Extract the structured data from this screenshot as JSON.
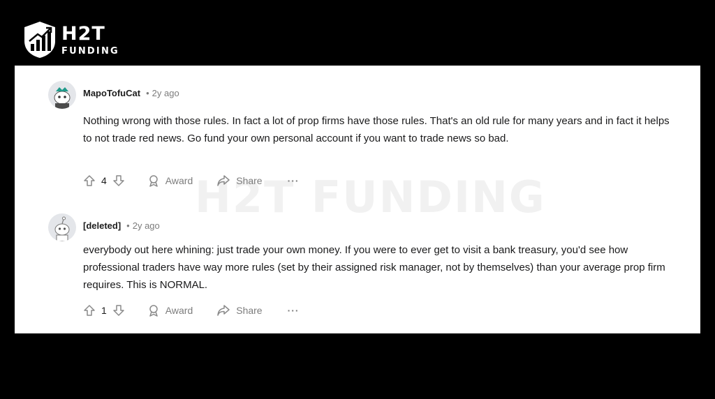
{
  "brand": {
    "name": "H2T",
    "sub": "FUNDING"
  },
  "watermark": "H2T FUNDING",
  "comments": [
    {
      "author": "MapoTofuCat",
      "separator": "•",
      "time": "2y ago",
      "body": "Nothing wrong with those rules. In fact a lot of prop firms have those rules. That's an old rule for many years and in fact it helps to not trade red news. Go fund your own personal account if you want to trade news so bad.",
      "votes": "4",
      "award_label": "Award",
      "share_label": "Share",
      "more": "···"
    },
    {
      "author": "[deleted]",
      "separator": "•",
      "time": "2y ago",
      "body": "everybody out here whining: just trade your own money. If you were to ever get to visit a bank treasury, you'd see how professional traders have way more rules (set by their assigned risk manager, not by themselves) than your average prop firm requires. This is NORMAL.",
      "votes": "1",
      "award_label": "Award",
      "share_label": "Share",
      "more": "···"
    }
  ],
  "icons": [
    "shield-logo-icon",
    "upvote-icon",
    "downvote-icon",
    "award-icon",
    "share-icon",
    "more-icon"
  ],
  "colors": {
    "background": "#000000",
    "panel": "#ffffff",
    "muted": "#7c7c7c",
    "text": "#1a1a1b"
  }
}
